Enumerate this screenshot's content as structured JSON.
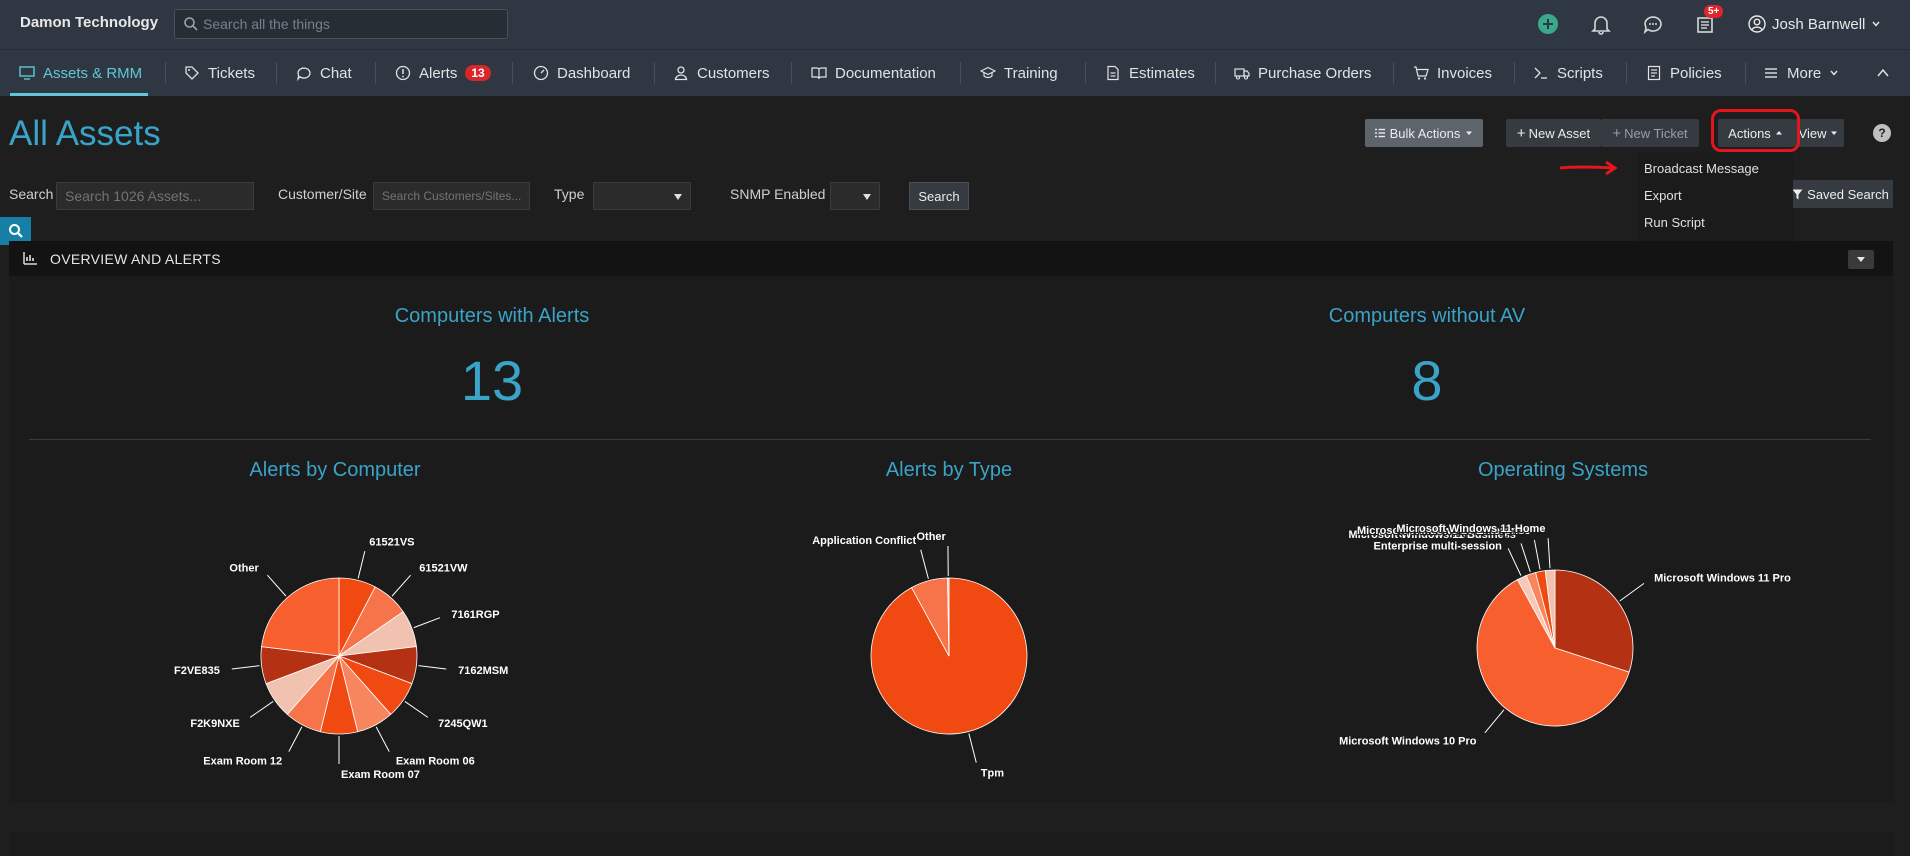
{
  "app": {
    "brand": "Damon Technology",
    "search_placeholder": "Search all the things",
    "notification_badge": "5+",
    "user_name": "Josh Barnwell"
  },
  "nav": {
    "items": [
      {
        "label": "Assets & RMM",
        "icon": "monitor-icon"
      },
      {
        "label": "Tickets",
        "icon": "tag-icon"
      },
      {
        "label": "Chat",
        "icon": "chat-icon"
      },
      {
        "label": "Alerts",
        "icon": "alert-circle-icon",
        "badge": "13"
      },
      {
        "label": "Dashboard",
        "icon": "dashboard-icon"
      },
      {
        "label": "Customers",
        "icon": "user-icon"
      },
      {
        "label": "Documentation",
        "icon": "book-icon"
      },
      {
        "label": "Training",
        "icon": "graduation-cap-icon"
      },
      {
        "label": "Estimates",
        "icon": "document-icon"
      },
      {
        "label": "Purchase Orders",
        "icon": "truck-icon"
      },
      {
        "label": "Invoices",
        "icon": "cart-icon"
      },
      {
        "label": "Scripts",
        "icon": "terminal-icon"
      },
      {
        "label": "Policies",
        "icon": "policy-icon"
      },
      {
        "label": "More",
        "icon": "hamburger-icon"
      }
    ]
  },
  "header": {
    "title": "All Assets",
    "bulk_actions": "Bulk Actions",
    "new_asset": "New Asset",
    "new_ticket": "New Ticket",
    "actions": "Actions",
    "view": "View",
    "help": "?"
  },
  "actions_menu": {
    "items": [
      "Broadcast Message",
      "Export",
      "Run Script"
    ]
  },
  "filters": {
    "search_label": "Search",
    "search_placeholder": "Search 1026 Assets...",
    "customer_label": "Customer/Site",
    "customer_placeholder": "Search Customers/Sites...",
    "type_label": "Type",
    "snmp_label": "SNMP Enabled",
    "search_button": "Search",
    "saved_search": "Saved Search"
  },
  "overview": {
    "title": "OVERVIEW AND ALERTS",
    "stats": [
      {
        "title": "Computers with Alerts",
        "value": "13"
      },
      {
        "title": "Computers without AV",
        "value": "8"
      }
    ]
  },
  "colors": {
    "accent": "#3aa3c8",
    "nav_active": "#5fc7d8",
    "topbar": "#2f3742",
    "alert_red": "#d9262a"
  },
  "chart_data": [
    {
      "type": "pie",
      "title": "Alerts by Computer",
      "categories": [
        "61521VS",
        "61521VW",
        "7161RGP",
        "7162MSM",
        "7245QW1",
        "Exam Room 06",
        "Exam Room 07",
        "Exam Room 12",
        "F2K9NXE",
        "F2VE835",
        "Other"
      ],
      "values": [
        1,
        1,
        1,
        1,
        1,
        1,
        1,
        1,
        1,
        1,
        3
      ],
      "colors": [
        "#f04a12",
        "#f7744a",
        "#f2c2b0",
        "#b43213",
        "#f04a12",
        "#f7865f",
        "#f04a12",
        "#f7744a",
        "#f2c2b0",
        "#b43213",
        "#f7602e"
      ]
    },
    {
      "type": "pie",
      "title": "Alerts by Type",
      "categories": [
        "Tpm",
        "Application Conflict",
        "Other"
      ],
      "values": [
        12,
        1,
        0.04
      ],
      "colors": [
        "#f04a12",
        "#f7744a",
        "#f7c8b8"
      ]
    },
    {
      "type": "pie",
      "title": "Operating Systems",
      "categories": [
        "Microsoft Windows 11 Pro",
        "Microsoft Windows 10 Pro",
        "Microsoft Windows 11 Enterprise multi-session",
        "Microsoft Windows 11 Business",
        "Microsoft Windows 10 Enterprise",
        "Microsoft Windows 11 Home"
      ],
      "values": [
        30,
        62,
        2,
        2,
        2,
        2
      ],
      "label_lines": {
        "Microsoft Windows 11 Enterprise multi-session": [
          "Microsoft Windows 11",
          "Enterprise multi-session"
        ]
      },
      "colors": [
        "#b43213",
        "#f7602e",
        "#f7c8b8",
        "#f7865f",
        "#f04a12",
        "#f2c2b0"
      ]
    }
  ]
}
